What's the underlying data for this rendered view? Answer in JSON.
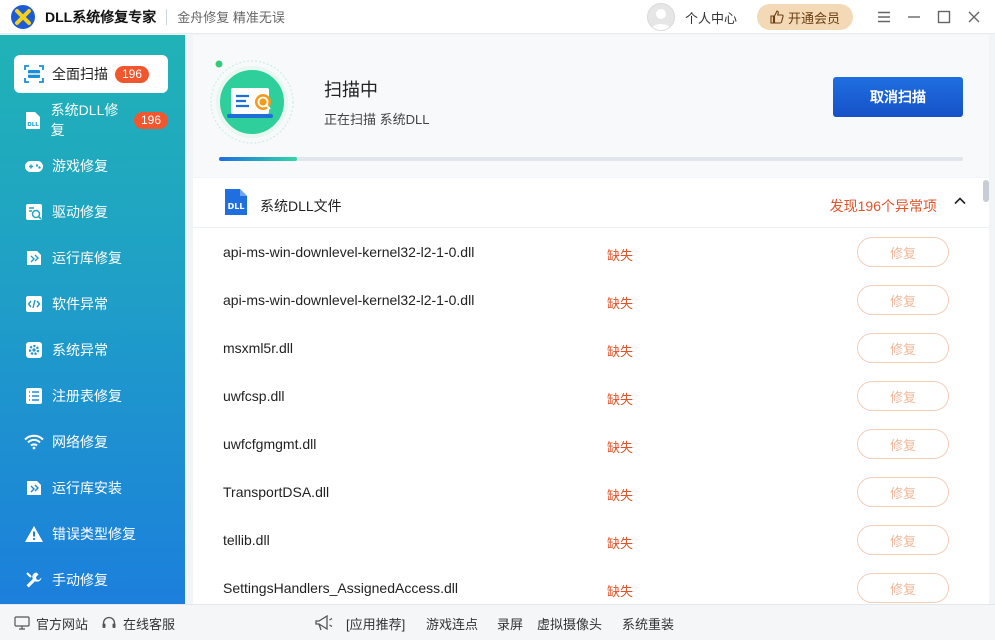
{
  "app": {
    "title": "DLL系统修复专家",
    "slogan": "金舟修复 精准无误",
    "user_center": "个人中心",
    "vip_label": "开通会员"
  },
  "sidebar": {
    "items": [
      {
        "label": "全面扫描",
        "badge": "196",
        "icon": "scan-icon"
      },
      {
        "label": "系统DLL修复",
        "badge": "196",
        "icon": "dll-file-icon"
      },
      {
        "label": "游戏修复",
        "icon": "gamepad-icon"
      },
      {
        "label": "驱动修复",
        "icon": "driver-icon"
      },
      {
        "label": "运行库修复",
        "icon": "runtime-icon"
      },
      {
        "label": "软件异常",
        "icon": "software-icon"
      },
      {
        "label": "系统异常",
        "icon": "gear-icon"
      },
      {
        "label": "注册表修复",
        "icon": "list-icon"
      },
      {
        "label": "网络修复",
        "icon": "wifi-icon"
      },
      {
        "label": "运行库安装",
        "icon": "runtime-install-icon"
      },
      {
        "label": "错误类型修复",
        "icon": "warning-icon"
      },
      {
        "label": "手动修复",
        "icon": "wrench-icon"
      }
    ]
  },
  "scan": {
    "title": "扫描中",
    "subtitle": "正在扫描 系统DLL",
    "cancel_label": "取消扫描",
    "progress": 0.105
  },
  "group": {
    "title": "系统DLL文件",
    "count_text": "发现196个异常项"
  },
  "rows": [
    {
      "name": "api-ms-win-downlevel-kernel32-l2-1-0.dll",
      "status": "缺失",
      "action": "修复"
    },
    {
      "name": "api-ms-win-downlevel-kernel32-l2-1-0.dll",
      "status": "缺失",
      "action": "修复"
    },
    {
      "name": "msxml5r.dll",
      "status": "缺失",
      "action": "修复"
    },
    {
      "name": "uwfcsp.dll",
      "status": "缺失",
      "action": "修复"
    },
    {
      "name": "uwfcfgmgmt.dll",
      "status": "缺失",
      "action": "修复"
    },
    {
      "name": "TransportDSA.dll",
      "status": "缺失",
      "action": "修复"
    },
    {
      "name": "tellib.dll",
      "status": "缺失",
      "action": "修复"
    },
    {
      "name": "SettingsHandlers_AssignedAccess.dll",
      "status": "缺失",
      "action": "修复"
    }
  ],
  "bottom": {
    "website": "官方网站",
    "service": "在线客服",
    "recommend": "[应用推荐]",
    "links": [
      "游戏连点",
      "录屏",
      "虚拟摄像头",
      "系统重装"
    ]
  },
  "colors": {
    "accent": "#1f6fe0",
    "warning": "#e2532a",
    "sidebar_top": "#20b3b6",
    "sidebar_bottom": "#1c7fdc"
  }
}
